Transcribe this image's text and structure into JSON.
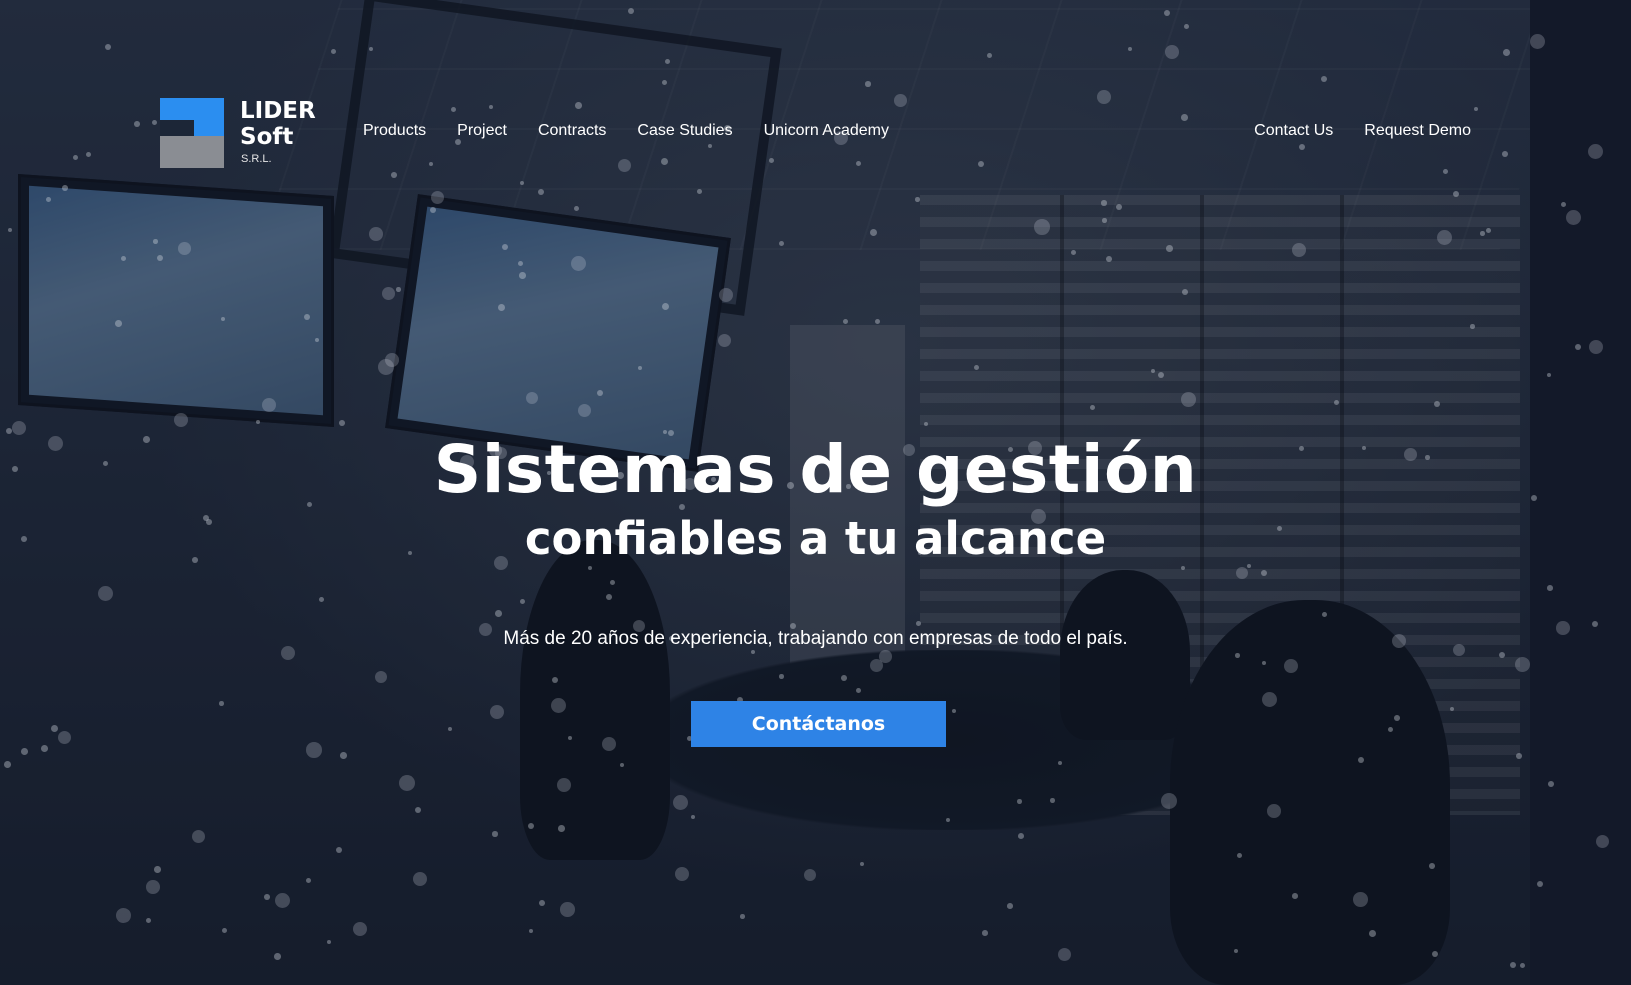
{
  "brand": {
    "name_line1": "LIDER",
    "name_line2": "Soft",
    "suffix": "S.R.L.",
    "colors": {
      "primary": "#2b8ef0",
      "secondary": "#8a8d93"
    }
  },
  "nav": {
    "items": [
      {
        "label": "Products"
      },
      {
        "label": "Project"
      },
      {
        "label": "Contracts"
      },
      {
        "label": "Case Studies"
      },
      {
        "label": "Unicorn Academy"
      }
    ],
    "right_items": [
      {
        "label": "Contact Us"
      },
      {
        "label": "Request Demo"
      }
    ]
  },
  "hero": {
    "headline": "Sistemas de gestión",
    "subheadline": "confiables a tu alcance",
    "tagline": "Más de 20 años de experiencia, trabajando con empresas de todo el país.",
    "cta_label": "Contáctanos",
    "cta_color": "#2e83e6",
    "background": "photo-conference-room"
  }
}
